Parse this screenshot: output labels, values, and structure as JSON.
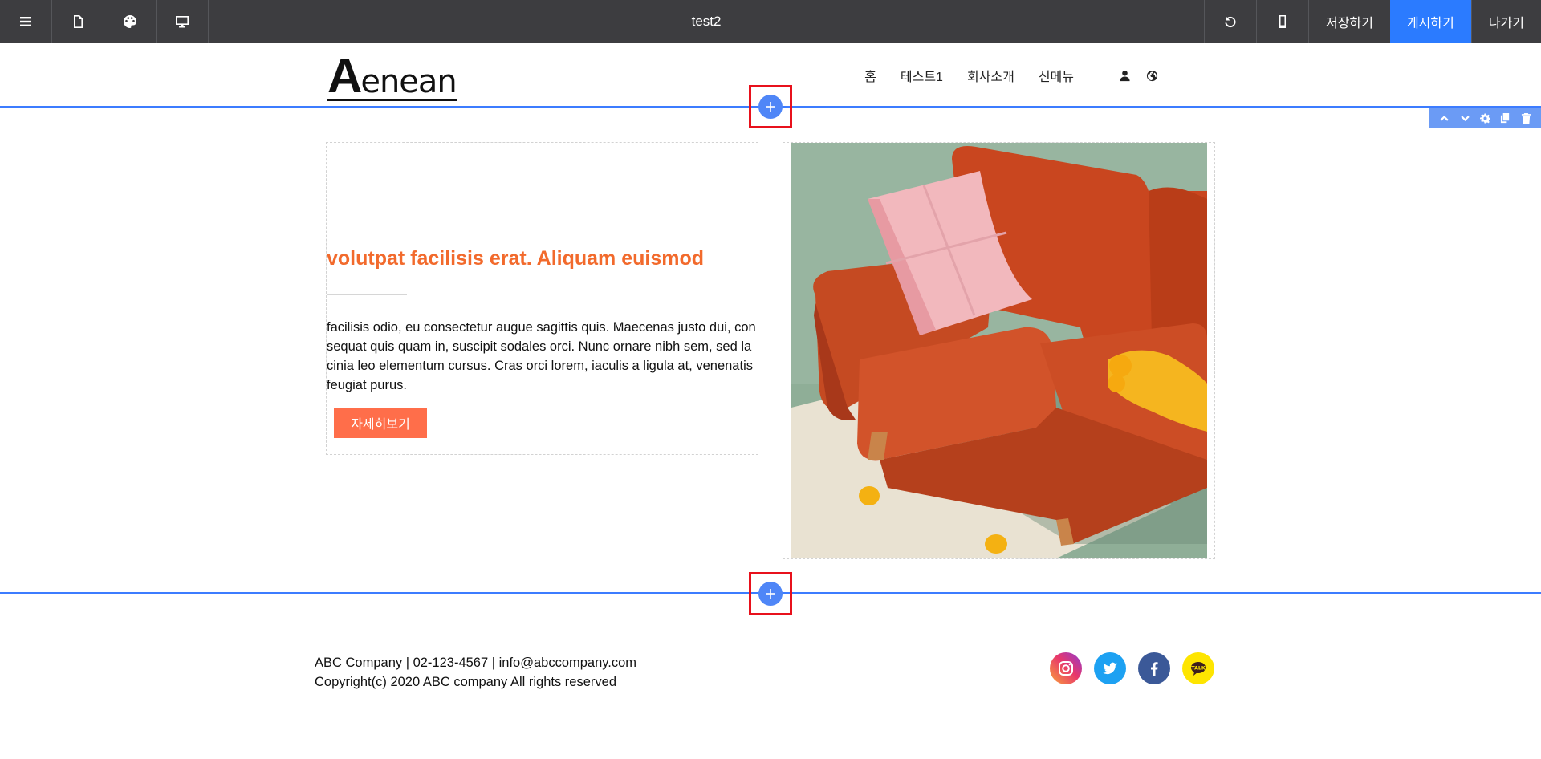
{
  "toolbar": {
    "title": "test2",
    "save_label": "저장하기",
    "publish_label": "게시하기",
    "exit_label": "나가기",
    "publish_color": "#2b7bff"
  },
  "header": {
    "logo_initial": "A",
    "logo_rest": "enean",
    "nav": [
      "홈",
      "테스트1",
      "회사소개",
      "신메뉴"
    ]
  },
  "content": {
    "headline": "volutpat facilisis erat. Aliquam euismod",
    "headline_color": "#f26a2c",
    "body": "facilisis odio, eu consectetur augue sagittis quis. Maecenas justo dui, consequat quis quam in, suscipit sodales orci. Nunc ornare nibh sem, sed lacinia leo elementum cursus. Cras orci lorem, iaculis a ligula at, venenatis feugiat purus.",
    "button_label": "자세히보기",
    "button_color": "#ff6e4a"
  },
  "footer": {
    "line1": "ABC Company | 02-123-4567 | info@abccompany.com",
    "line2": "Copyright(c) 2020 ABC company All rights reserved",
    "kakao_label": "TALK"
  },
  "icons": {
    "toolbar_left": [
      "menu-icon",
      "page-icon",
      "palette-icon",
      "desktop-icon"
    ],
    "toolbar_right": [
      "undo-icon",
      "mobile-icon"
    ],
    "header": [
      "user-icon",
      "globe-icon"
    ],
    "section_tools": [
      "chevron-up-icon",
      "chevron-down-icon",
      "gear-icon",
      "copy-icon",
      "trash-icon"
    ],
    "socials": [
      "instagram-icon",
      "twitter-icon",
      "facebook-icon",
      "kakaotalk-icon"
    ]
  }
}
